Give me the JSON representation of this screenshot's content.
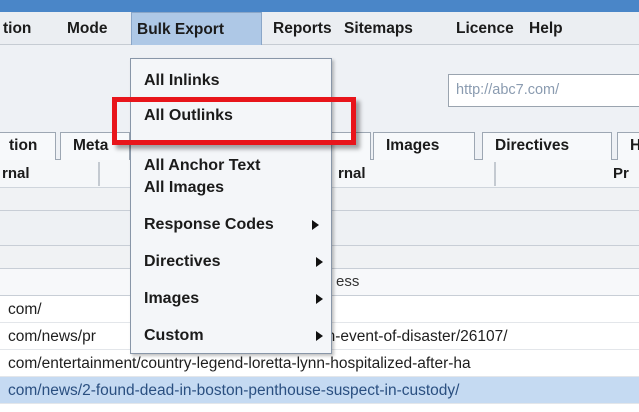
{
  "menubar": {
    "items": [
      "tion",
      "Mode",
      "Bulk Export",
      "Reports",
      "Sitemaps",
      "Licence",
      "Help"
    ],
    "active": "Bulk Export"
  },
  "toolbar": {
    "url_value": "http://abc7.com/"
  },
  "tabs": [
    "tion",
    "Meta",
    "Images",
    "Directives",
    "H"
  ],
  "filters": [
    "rnal",
    "rnal",
    "Pr"
  ],
  "column_header": "ess",
  "rows": [
    "com/",
    "com/news/pr",
    "com/entertainment/country-legend-loretta-lynn-hospitalized-after-ha",
    "com/news/2-found-dead-in-boston-penthouse-suspect-in-custody/"
  ],
  "row_fragment": "-in-event-of-disaster/26107/",
  "selected_row": 3,
  "bulk_export_menu": {
    "items": [
      {
        "label": "All Inlinks",
        "submenu": false
      },
      {
        "label": "All Outlinks",
        "submenu": false
      },
      {
        "label": "All Anchor Text",
        "submenu": false
      },
      {
        "label": "All Images",
        "submenu": false
      },
      {
        "label": "Response Codes",
        "submenu": true
      },
      {
        "label": "Directives",
        "submenu": true
      },
      {
        "label": "Images",
        "submenu": true
      },
      {
        "label": "Custom",
        "submenu": true
      }
    ],
    "highlighted": "All Outlinks"
  },
  "colors": {
    "highlight_box": "#e8151b",
    "menu_active": "#aec8e6",
    "selected_row": "#c5daf2",
    "title_bar": "#4a86c8"
  }
}
